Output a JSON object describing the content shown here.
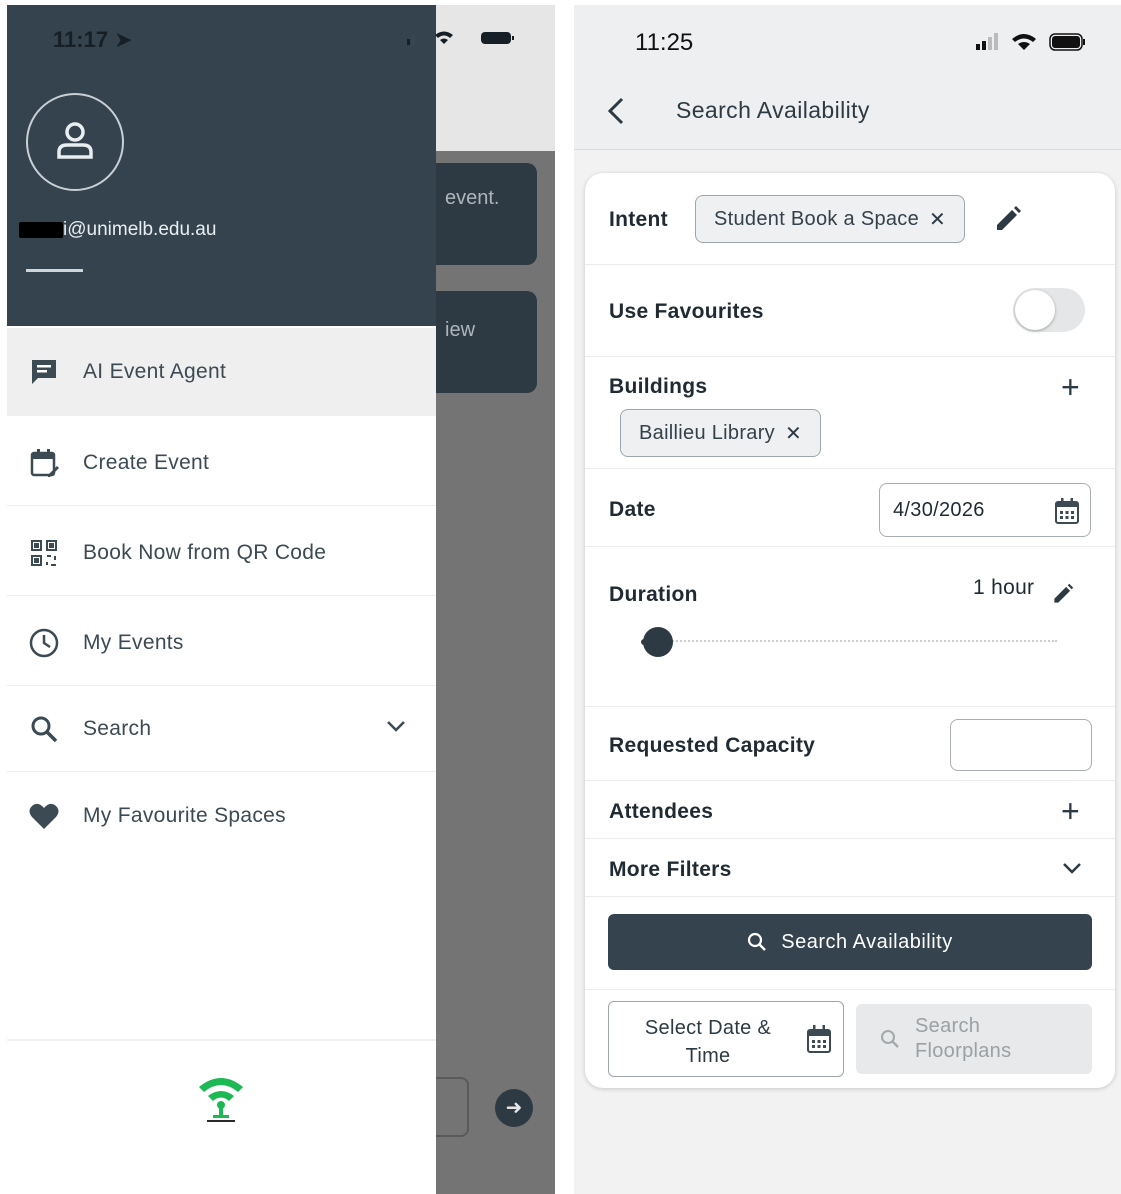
{
  "left": {
    "status_time": "11:17",
    "email": "i@unimelb.edu.au",
    "background_card_1": "event.",
    "background_card_2": "iew",
    "menu": [
      {
        "label": "AI Event Agent",
        "icon": "chat-icon",
        "active": true
      },
      {
        "label": "Create Event",
        "icon": "calendar-edit-icon"
      },
      {
        "label": "Book Now from QR Code",
        "icon": "qr-code-icon"
      },
      {
        "label": "My Events",
        "icon": "clock-icon"
      },
      {
        "label": "Search",
        "icon": "search-icon",
        "expandable": true
      },
      {
        "label": "My Favourite Spaces",
        "icon": "heart-icon"
      }
    ],
    "logo": "apptree-logo",
    "colors": {
      "header": "#34434d",
      "active_row": "#efefef"
    }
  },
  "right": {
    "status_time": "11:25",
    "nav_title": "Search Availability",
    "intent": {
      "label": "Intent",
      "value": "Student Book a Space"
    },
    "use_favourites": {
      "label": "Use Favourites",
      "enabled": false
    },
    "buildings": {
      "label": "Buildings",
      "items": [
        "Baillieu Library"
      ]
    },
    "date": {
      "label": "Date",
      "value": "4/30/2026"
    },
    "duration": {
      "label": "Duration",
      "value": "1 hour",
      "slider_fraction": 0.0
    },
    "requested_capacity": {
      "label": "Requested Capacity",
      "value": ""
    },
    "attendees": {
      "label": "Attendees"
    },
    "more_filters": {
      "label": "More Filters"
    },
    "search_button": "Search Availability",
    "select_date_time": "Select Date & Time",
    "search_floorplans": "Search Floorplans",
    "colors": {
      "primary": "#34434d",
      "disabled_bg": "#e8e9ea"
    }
  }
}
